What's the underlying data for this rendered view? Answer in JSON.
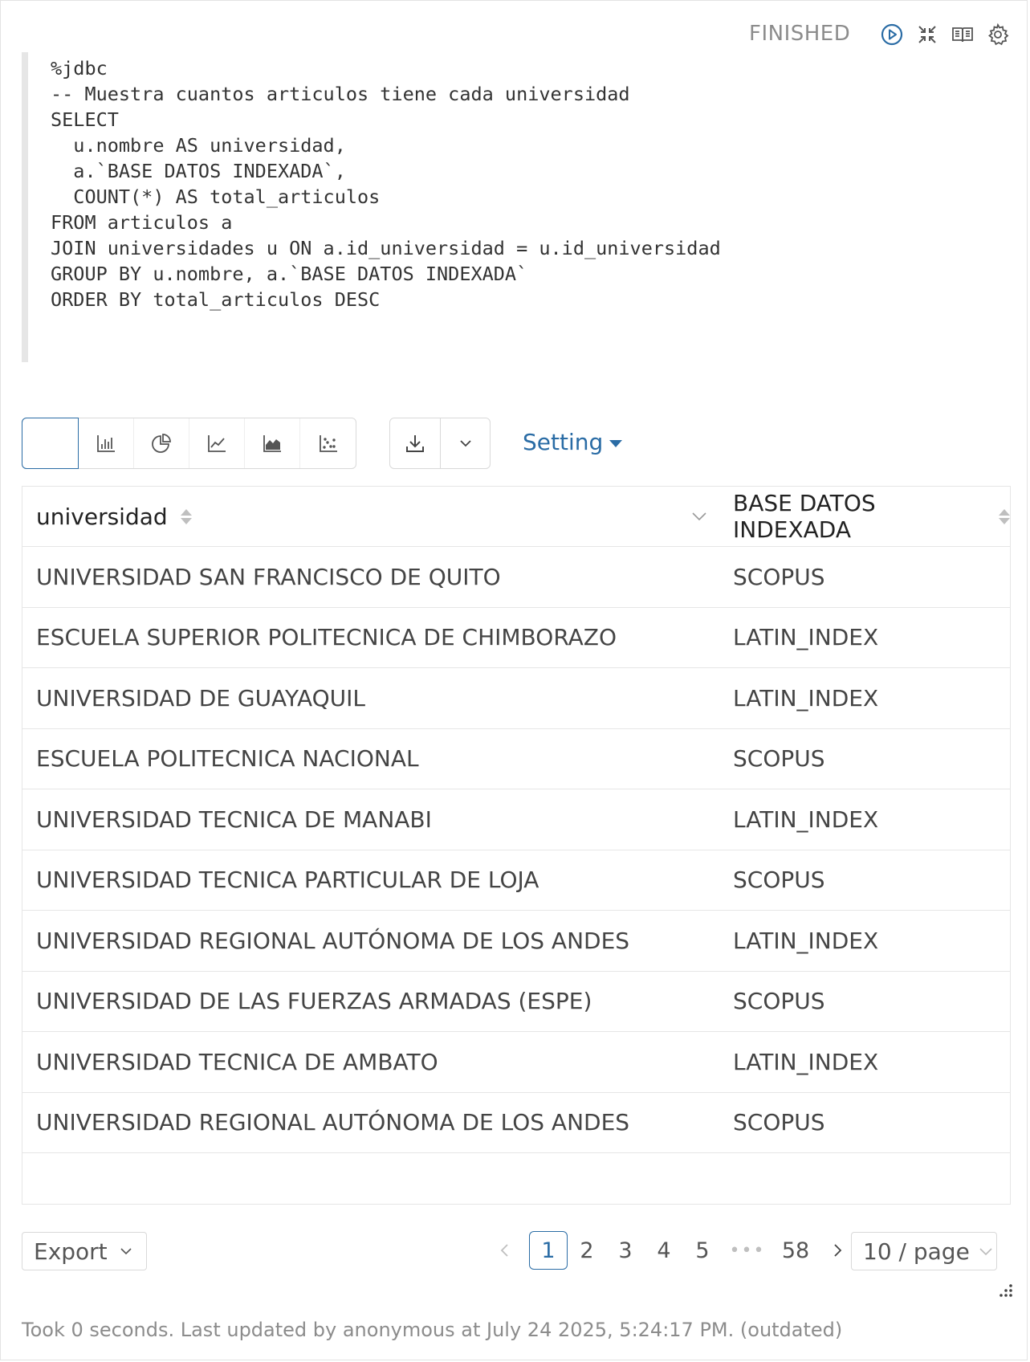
{
  "toolbar": {
    "status": "FINISHED",
    "icons": [
      "run-icon",
      "collapse-icon",
      "book-icon",
      "gear-icon"
    ]
  },
  "editor": {
    "code": "%jdbc\n-- Muestra cuantos articulos tiene cada universidad\nSELECT\n  u.nombre AS universidad,\n  a.`BASE DATOS INDEXADA`,\n  COUNT(*) AS total_articulos\nFROM articulos a\nJOIN universidades u ON a.id_universidad = u.id_universidad\nGROUP BY u.nombre, a.`BASE DATOS INDEXADA`\nORDER BY total_articulos DESC"
  },
  "viz": {
    "modes": [
      "table-icon",
      "bar-chart-icon",
      "pie-chart-icon",
      "line-chart-icon",
      "area-chart-icon",
      "scatter-chart-icon"
    ],
    "setting_label": "Setting"
  },
  "table": {
    "columns": [
      "universidad",
      "BASE DATOS INDEXADA"
    ],
    "rows": [
      [
        "UNIVERSIDAD SAN FRANCISCO DE QUITO",
        "SCOPUS"
      ],
      [
        "ESCUELA SUPERIOR POLITECNICA DE CHIMBORAZO",
        "LATIN_INDEX"
      ],
      [
        "UNIVERSIDAD DE GUAYAQUIL",
        "LATIN_INDEX"
      ],
      [
        "ESCUELA POLITECNICA NACIONAL",
        "SCOPUS"
      ],
      [
        "UNIVERSIDAD TECNICA DE MANABI",
        "LATIN_INDEX"
      ],
      [
        "UNIVERSIDAD TECNICA PARTICULAR DE LOJA",
        "SCOPUS"
      ],
      [
        "UNIVERSIDAD REGIONAL AUTÓNOMA DE LOS ANDES",
        "LATIN_INDEX"
      ],
      [
        "UNIVERSIDAD DE LAS FUERZAS ARMADAS (ESPE)",
        "SCOPUS"
      ],
      [
        "UNIVERSIDAD TECNICA DE AMBATO",
        "LATIN_INDEX"
      ],
      [
        "UNIVERSIDAD REGIONAL AUTÓNOMA DE LOS ANDES",
        "SCOPUS"
      ]
    ]
  },
  "pagination": {
    "export_label": "Export",
    "pages": [
      "1",
      "2",
      "3",
      "4",
      "5"
    ],
    "ellipsis": "•••",
    "last_page": "58",
    "current_page": "1",
    "page_size": "10 / page"
  },
  "footer": {
    "text": "Took 0 seconds. Last updated by anonymous at July 24 2025, 5:24:17 PM. (outdated)"
  },
  "colors": {
    "accent": "#2a6ca5",
    "border": "#d9d9d9",
    "muted": "#8c8c8c"
  }
}
